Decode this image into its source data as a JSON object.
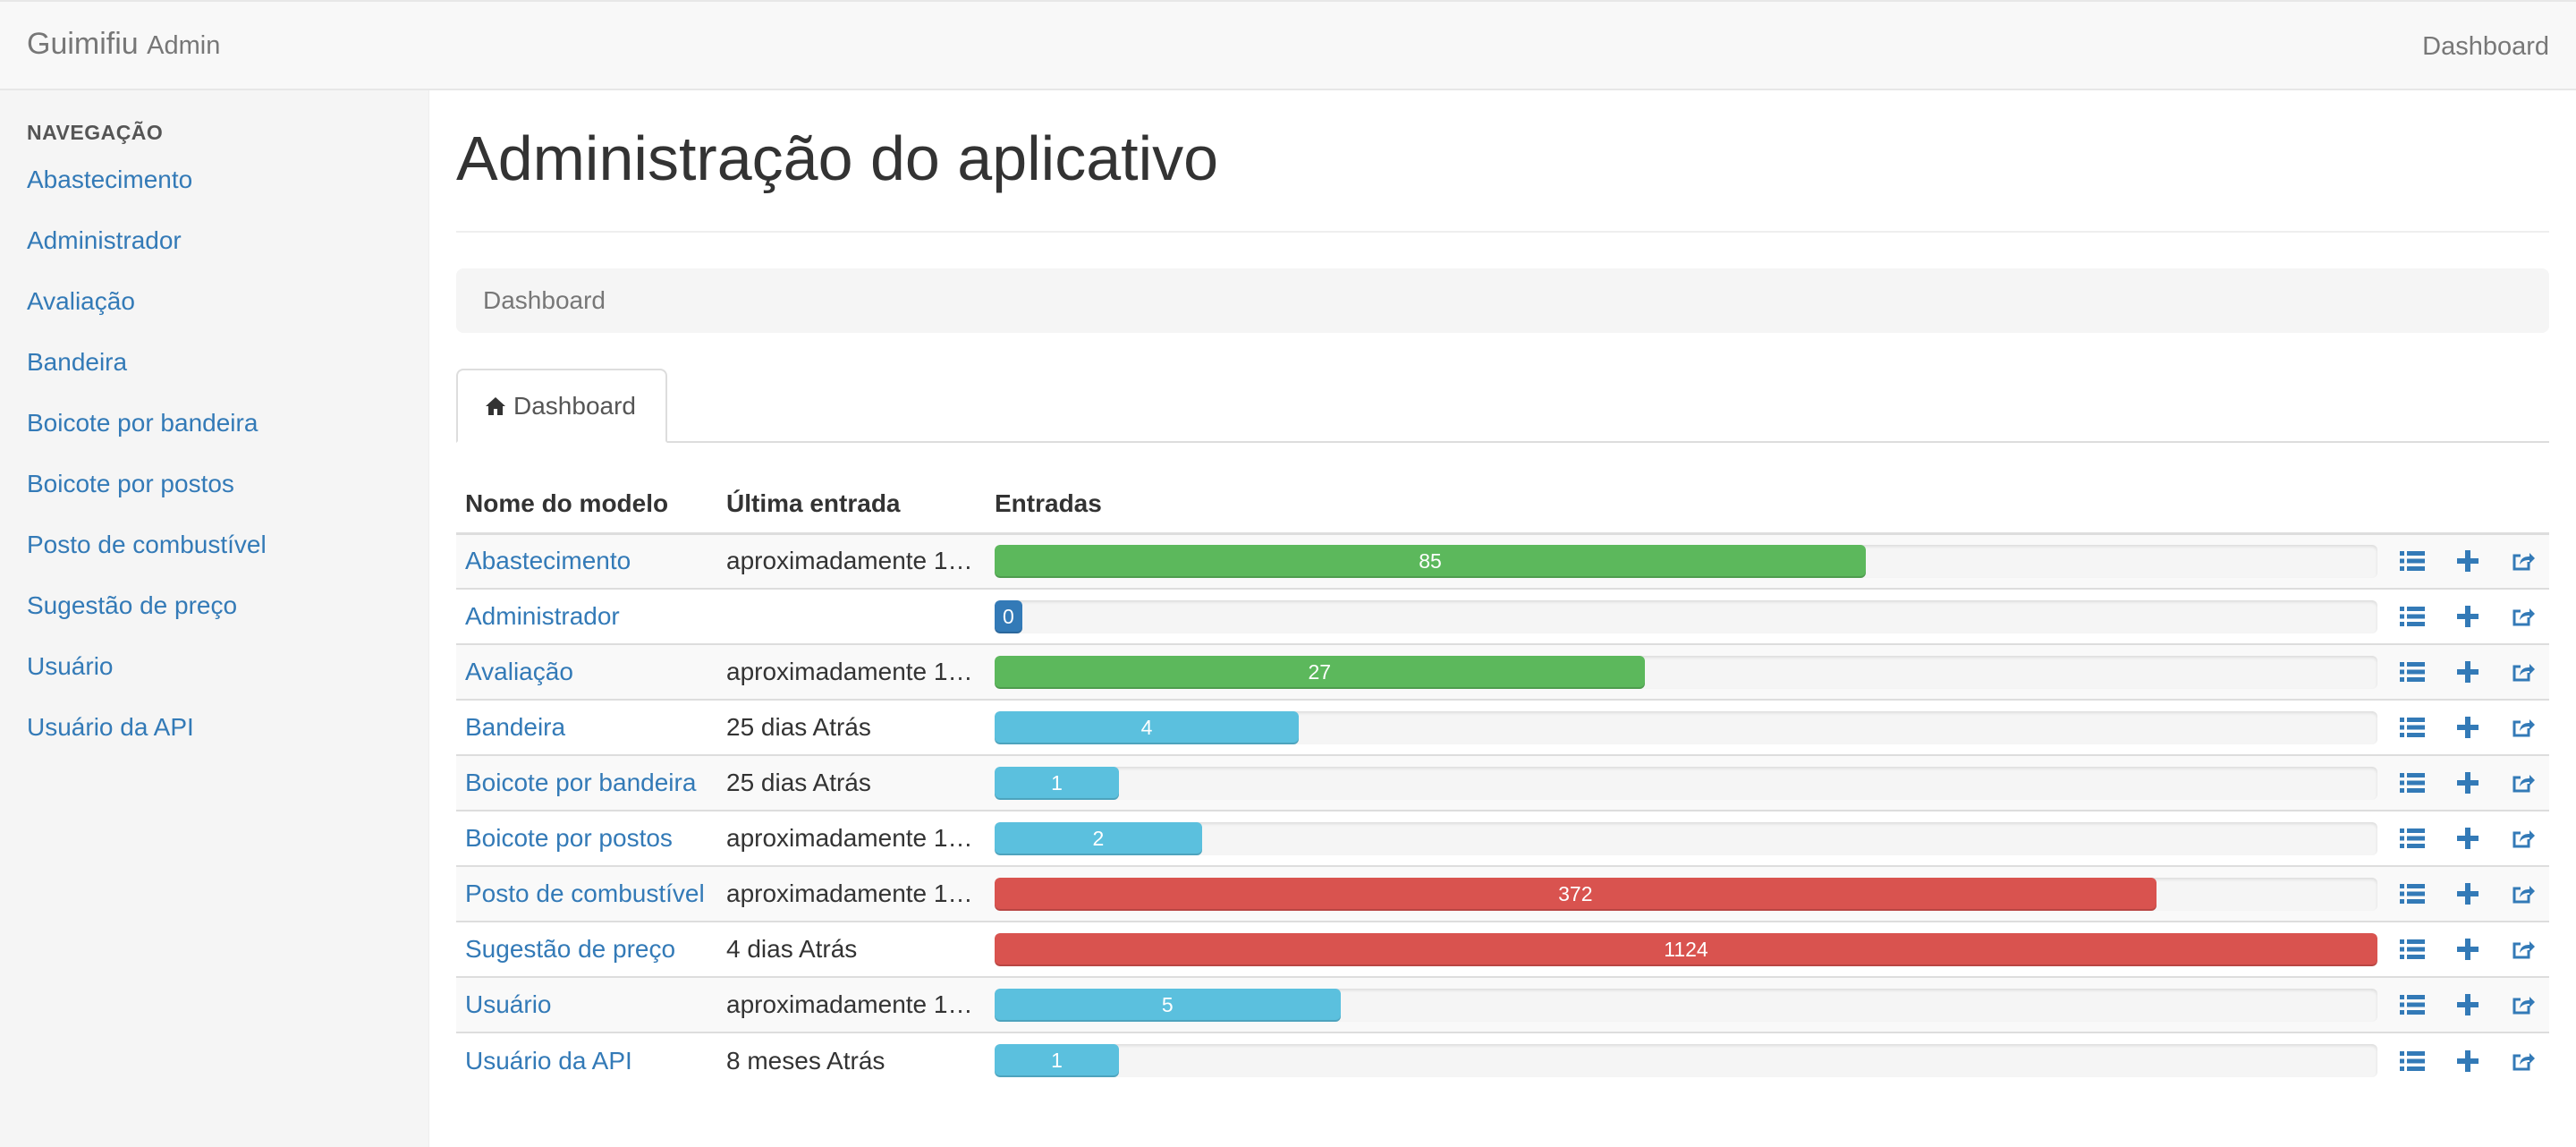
{
  "navbar": {
    "brand": "Guimifiu",
    "brand_sub": "Admin",
    "right_link": "Dashboard"
  },
  "sidebar": {
    "header": "NAVEGAÇÃO",
    "items": [
      {
        "label": "Abastecimento"
      },
      {
        "label": "Administrador"
      },
      {
        "label": "Avaliação"
      },
      {
        "label": "Bandeira"
      },
      {
        "label": "Boicote por bandeira"
      },
      {
        "label": "Boicote por postos"
      },
      {
        "label": "Posto de combustível"
      },
      {
        "label": "Sugestão de preço"
      },
      {
        "label": "Usuário"
      },
      {
        "label": "Usuário da API"
      }
    ]
  },
  "main": {
    "title": "Administração do aplicativo",
    "breadcrumb": "Dashboard",
    "tab_label": "Dashboard",
    "tab_icon": "home-icon"
  },
  "table": {
    "headers": [
      "Nome do modelo",
      "Última entrada",
      "Entradas"
    ],
    "max_entries": 1124,
    "action_icons": [
      "list-icon",
      "plus-icon",
      "share-icon"
    ],
    "rows": [
      {
        "name": "Abastecimento",
        "last": "aproximadamente 1…",
        "count": 85,
        "color": "#5cb85c"
      },
      {
        "name": "Administrador",
        "last": "",
        "count": 0,
        "color": "#337ab7"
      },
      {
        "name": "Avaliação",
        "last": "aproximadamente 1…",
        "count": 27,
        "color": "#5cb85c"
      },
      {
        "name": "Bandeira",
        "last": "25 dias Atrás",
        "count": 4,
        "color": "#5bc0de"
      },
      {
        "name": "Boicote por bandeira",
        "last": "25 dias Atrás",
        "count": 1,
        "color": "#5bc0de"
      },
      {
        "name": "Boicote por postos",
        "last": "aproximadamente 1…",
        "count": 2,
        "color": "#5bc0de"
      },
      {
        "name": "Posto de combustível",
        "last": "aproximadamente 1…",
        "count": 372,
        "color": "#d9534f"
      },
      {
        "name": "Sugestão de preço",
        "last": "4 dias Atrás",
        "count": 1124,
        "color": "#d9534f"
      },
      {
        "name": "Usuário",
        "last": "aproximadamente 1…",
        "count": 5,
        "color": "#5bc0de"
      },
      {
        "name": "Usuário da API",
        "last": "8 meses Atrás",
        "count": 1,
        "color": "#5bc0de"
      }
    ],
    "bar_fill_fractions": [
      0.63,
      0.02,
      0.47,
      0.22,
      0.09,
      0.15,
      0.84,
      1.0,
      0.25,
      0.09
    ]
  }
}
